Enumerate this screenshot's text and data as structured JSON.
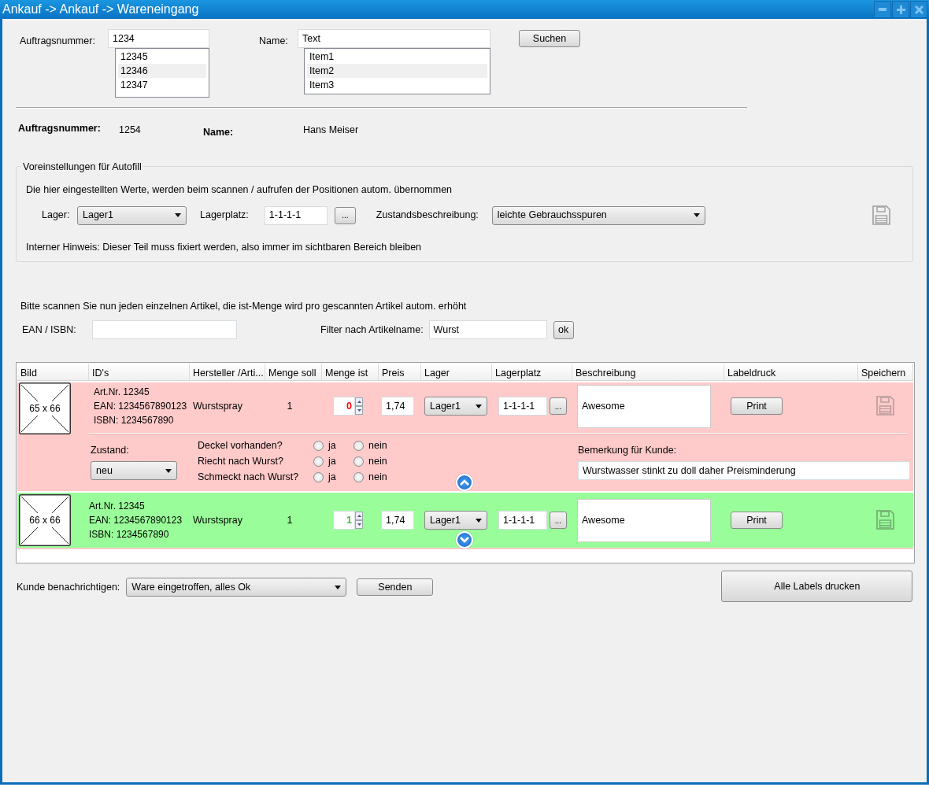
{
  "window": {
    "title": "Ankauf -> Ankauf -> Wareneingang"
  },
  "search": {
    "order": {
      "label": "Auftragsnummer:",
      "value": "1234",
      "suggestions": [
        {
          "text": "12345",
          "selected": false
        },
        {
          "text": "12346",
          "selected": true
        },
        {
          "text": "12347",
          "selected": false
        }
      ]
    },
    "name": {
      "label": "Name:",
      "value": "Text",
      "suggestions": [
        {
          "text": "Item1",
          "selected": false
        },
        {
          "text": "Item2",
          "selected": true
        },
        {
          "text": "Item3",
          "selected": false
        }
      ]
    },
    "button": "Suchen"
  },
  "summary": [
    {
      "label": "Auftragsnummer:",
      "value": "1254"
    },
    {
      "label": "Name:",
      "value": "Hans Meiser"
    }
  ],
  "autofill": {
    "legend": "Voreinstellungen für Autofill",
    "hint": "Die hier eingestellten Werte, werden beim scannen / aufrufen der Positionen autom. übernommen",
    "lager": {
      "label": "Lager:",
      "value": "Lager1"
    },
    "lagerplatz": {
      "label": "Lagerplatz:",
      "value": "1-1-1-1",
      "button": "..."
    },
    "zustand": {
      "label": "Zustandsbeschreibung:",
      "value": "leichte Gebrauchsspuren"
    },
    "note": "Interner Hinweis: Dieser Teil muss fixiert werden, also immer im sichtbaren Bereich bleiben"
  },
  "scan": {
    "instruction": "Bitte scannen Sie nun jeden einzelnen Artikel, die ist-Menge wird pro gescannten Artikel autom. erhöht",
    "ean": {
      "label": "EAN / ISBN:"
    },
    "filter": {
      "label": "Filter nach Artikelname:",
      "value": "Wurst",
      "button": "ok"
    }
  },
  "table": {
    "columns": [
      "Bild",
      "ID's",
      "Hersteller /Arti...",
      "Menge soll",
      "Menge ist",
      "Preis",
      "Lager",
      "Lagerplatz",
      "Beschreibung",
      "Labeldruck",
      "Speichern"
    ],
    "rows": [
      {
        "complete": false,
        "expanded": true,
        "image": "65 x 66",
        "ids": [
          "Art.Nr. 12345",
          "EAN: 1234567890123",
          "ISBN: 1234567890"
        ],
        "product": "Wurstspray",
        "qty_target": "1",
        "qty_actual": "0",
        "price": "1,74",
        "lager": "Lager1",
        "lagerplatz": "1-1-1-1",
        "lagerplatz_button": "...",
        "description": "Awesome",
        "print": "Print",
        "details": {
          "zustand_label": "Zustand:",
          "zustand_value": "neu",
          "questions": [
            {
              "text": "Deckel vorhanden?",
              "options": [
                {
                  "label": "ja",
                  "selected": false
                },
                {
                  "label": "nein",
                  "selected": false
                }
              ]
            },
            {
              "text": "Riecht nach Wurst?",
              "options": [
                {
                  "label": "ja",
                  "selected": false
                },
                {
                  "label": "nein",
                  "selected": false
                }
              ]
            },
            {
              "text": "Schmeckt nach Wurst?",
              "options": [
                {
                  "label": "ja",
                  "selected": false
                },
                {
                  "label": "nein",
                  "selected": false
                }
              ]
            }
          ],
          "remark_label": "Bemerkung für Kunde:",
          "remark_value": "Wurstwasser stinkt zu doll daher Preisminderung"
        }
      },
      {
        "complete": true,
        "expanded": false,
        "image": "66 x 66",
        "ids": [
          "Art.Nr. 12345",
          "EAN: 1234567890123",
          "ISBN: 1234567890"
        ],
        "product": "Wurstspray",
        "qty_target": "1",
        "qty_actual": "1",
        "price": "1,74",
        "lager": "Lager1",
        "lagerplatz": "1-1-1-1",
        "lagerplatz_button": "...",
        "description": "Awesome",
        "print": "Print"
      }
    ]
  },
  "footer": {
    "notify": {
      "label": "Kunde benachrichtigen:",
      "value": "Ware eingetroffen, alles Ok",
      "button": "Senden"
    },
    "print_all": "Alle Labels drucken"
  }
}
